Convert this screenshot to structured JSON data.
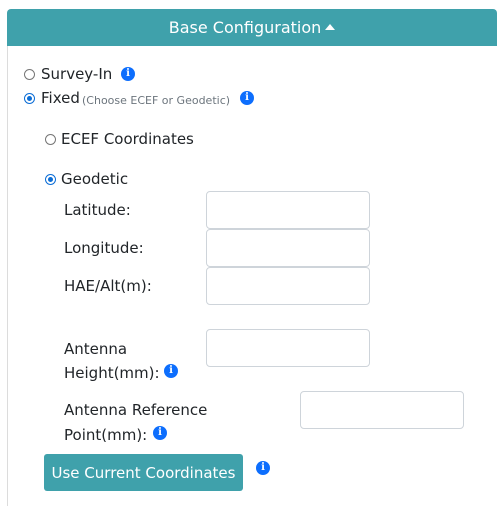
{
  "header": {
    "title": "Base Configuration"
  },
  "mode": {
    "survey_in": {
      "label": "Survey-In",
      "selected": false
    },
    "fixed": {
      "label": "Fixed",
      "hint": "(Choose ECEF or Geodetic)",
      "selected": true
    }
  },
  "coords": {
    "ecef": {
      "label": "ECEF Coordinates",
      "selected": false
    },
    "geodetic": {
      "label": "Geodetic",
      "selected": true
    }
  },
  "fields": {
    "latitude": {
      "label": "Latitude:",
      "value": ""
    },
    "longitude": {
      "label": "Longitude:",
      "value": ""
    },
    "hae": {
      "label": "HAE/Alt(m):",
      "value": ""
    },
    "antenna_height": {
      "label_line1": "Antenna",
      "label_line2": "Height(mm):",
      "value": ""
    },
    "antenna_ref": {
      "label_line1": "Antenna Reference",
      "label_line2": "Point(mm):",
      "value": ""
    }
  },
  "button": {
    "label": "Use Current Coordinates"
  },
  "colors": {
    "header_bg": "#3fa1ab",
    "button_bg": "#3fa1ab",
    "info_icon": "#0d6efd",
    "radio_selected": "#0b6dd6"
  }
}
